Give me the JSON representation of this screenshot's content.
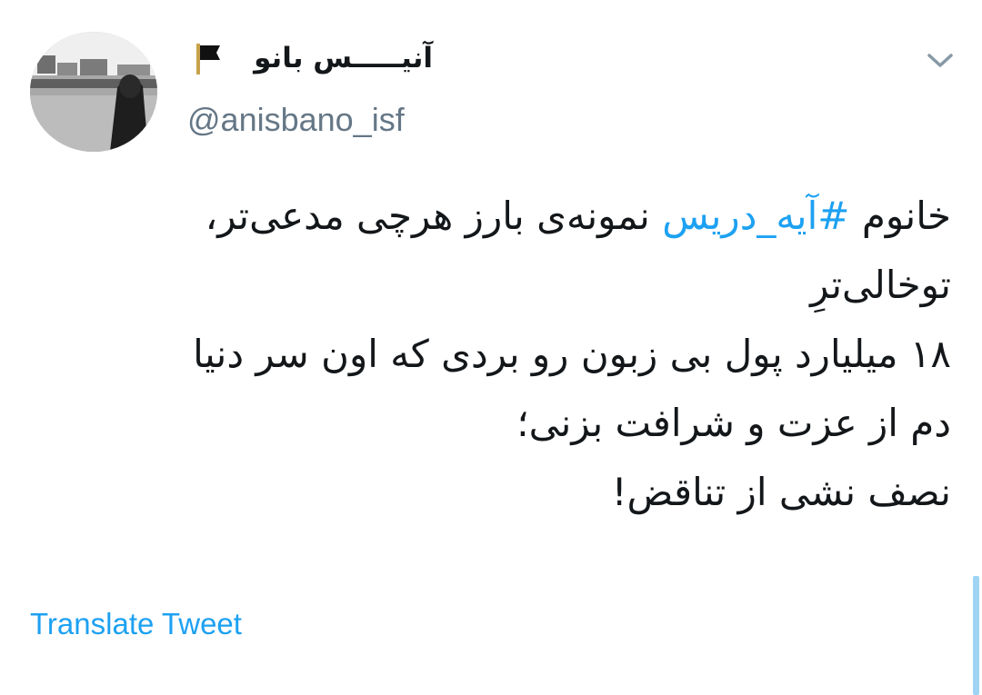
{
  "tweet": {
    "author": {
      "display_name": "آنیـــــس بانو",
      "handle": "@anisbano_isf",
      "name_emoji_icon": "black-flag-icon",
      "avatar_icon": "avatar-photo"
    },
    "menu_icon": "chevron-down-icon",
    "text": {
      "line1_prefix": "خانوم ",
      "hashtag": "#آیه_دریس",
      "line1_suffix": " نمونه‌ی بارز هرچی مدعی‌تر،",
      "line2": "توخالی‌ترِ",
      "line3": "۱۸ میلیارد پول بی زبون رو بردی که اون سر دنیا",
      "line4": "دم از عزت و شرافت بزنی؛",
      "line5": "نصف نشی از تناقض!"
    },
    "translate_label": "Translate Tweet"
  },
  "colors": {
    "link": "#1da1f2",
    "text": "#14171a",
    "secondary": "#657786",
    "scrollbar": "#9fd4f4"
  }
}
